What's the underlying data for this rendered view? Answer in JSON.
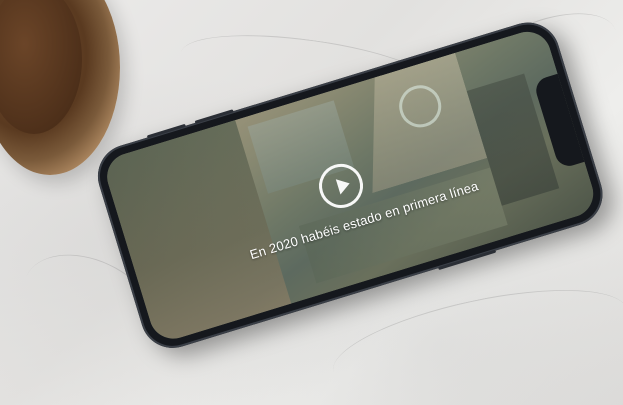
{
  "video_card": {
    "caption": "En 2020 habéis estado en primera línea",
    "play_icon": "play-icon"
  },
  "colors": {
    "marble": "#e6e5e3",
    "phone_frame": "#15181d",
    "caption_text": "#ffffff",
    "bowl": "#5a3a20"
  }
}
